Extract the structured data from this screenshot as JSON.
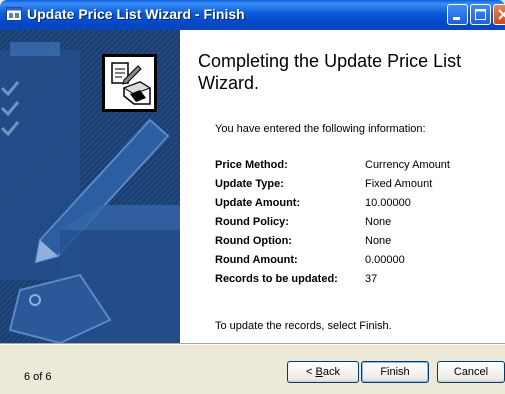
{
  "window": {
    "title": "Update Price List Wizard - Finish"
  },
  "heading": "Completing the Update Price List Wizard.",
  "intro": "You have entered the following information:",
  "summary": [
    {
      "label": "Price Method:",
      "value": "Currency Amount"
    },
    {
      "label": "Update Type:",
      "value": "Fixed Amount"
    },
    {
      "label": "Update Amount:",
      "value": "10.00000"
    },
    {
      "label": "Round Policy:",
      "value": "None"
    },
    {
      "label": "Round Option:",
      "value": "None"
    },
    {
      "label": "Round Amount:",
      "value": "0.00000"
    },
    {
      "label": "Records to be updated:",
      "value": "37"
    }
  ],
  "outro": "To update the records, select Finish.",
  "footer": {
    "step": "6 of 6",
    "back_prefix": "< ",
    "back_accel": "B",
    "back_rest": "ack",
    "finish": "Finish",
    "cancel": "Cancel"
  },
  "colors": {
    "titlebar": "#0a5bd9",
    "art_background": "#1a3e72"
  }
}
